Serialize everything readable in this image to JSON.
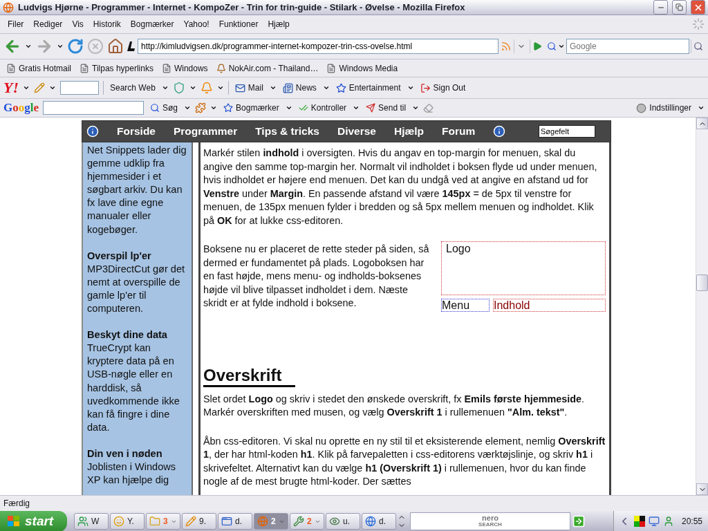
{
  "window": {
    "title": "Ludvigs Hjørne - Programmer - Internet - KompoZer - Trin for trin-guide - Stilark - Øvelse - Mozilla Firefox"
  },
  "menu": [
    "Filer",
    "Rediger",
    "Vis",
    "Historik",
    "Bogmærker",
    "Yahoo!",
    "Funktioner",
    "Hjælp"
  ],
  "navigation": {
    "url": "http://kimludvigsen.dk/programmer-internet-kompozer-trin-css-ovelse.html",
    "search_placeholder": "Google"
  },
  "bookmarks": [
    {
      "label": "Gratis Hotmail",
      "kind": "page"
    },
    {
      "label": "Tilpas hyperlinks",
      "kind": "page"
    },
    {
      "label": "Windows",
      "kind": "page"
    },
    {
      "label": "NokAir.com - Thailand…",
      "kind": "site"
    },
    {
      "label": "Windows Media",
      "kind": "page"
    }
  ],
  "yahoo_toolbar": {
    "logo": "Y!",
    "items": [
      {
        "label": "Search Web",
        "kind": "search"
      },
      {
        "label": "Mail",
        "kind": "mail"
      },
      {
        "label": "News",
        "kind": "news"
      },
      {
        "label": "Entertainment",
        "kind": "star"
      },
      {
        "label": "Sign Out",
        "kind": "signout"
      }
    ]
  },
  "google_toolbar": {
    "logo": "Google",
    "items": [
      {
        "label": "Søg",
        "kind": "search"
      },
      {
        "label": "Bogmærker",
        "kind": "star"
      },
      {
        "label": "Kontroller",
        "kind": "check"
      },
      {
        "label": "Send til",
        "kind": "send"
      }
    ],
    "settings": "Indstillinger"
  },
  "page": {
    "nav": [
      "Forside",
      "Programmer",
      "Tips & tricks",
      "Diverse",
      "Hjælp",
      "Forum"
    ],
    "search_value": "Søgefelt",
    "sidebar": [
      {
        "text": "Net Snippets lader dig gemme udklip fra hjemmesider i et søgbart arkiv. Du kan fx lave dine egne manualer eller kogebøger."
      },
      {
        "title": "Overspil lp'er",
        "text": "MP3DirectCut gør det nemt at overspille de gamle lp'er til computeren."
      },
      {
        "title": "Beskyt dine data",
        "text": "TrueCrypt kan kryptere data på en USB-nøgle eller en harddisk, så uvedkommende ikke kan få fingre i dine data."
      },
      {
        "title": "Din ven i nøden",
        "text": "Joblisten i Windows XP kan hjælpe dig"
      }
    ],
    "main": [
      {
        "kind": "paragraph",
        "text": "Markér stilen **indhold** i oversigten. Hvis du angav en top-margin for menuen, skal du angive den samme top-margin her. Normalt vil indholdet i boksen flyde ud under menuen, hvis indholdet er højere end menuen. Det kan du undgå ved at angive en afstand ud for **Venstre** under **Margin**. En passende afstand vil være **145px** = de 5px til venstre for menuen, de 135px menuen fylder i bredden og så 5px mellem menuen og indholdet. Klik på **OK** for at lukke css-editoren."
      },
      {
        "kind": "figure",
        "text": "Boksene nu er placeret de rette steder på siden, så dermed er fundamentet på plads. Logoboksen har en fast højde, mens menu- og indholds-boksenes højde vil blive tilpasset indholdet i dem. Næste skridt er at fylde indhold i boksene.",
        "logo": "Logo",
        "menu": "Menu",
        "content": "Indhold"
      },
      {
        "kind": "heading",
        "text": "Overskrift"
      },
      {
        "kind": "paragraph",
        "text": "Slet ordet **Logo** og skriv i stedet den ønskede overskrift, fx **Emils første hjemmeside**. Markér overskriften med musen, og vælg **Overskrift 1** i rullemenuen **\"Alm. tekst\"**."
      },
      {
        "kind": "paragraph",
        "text": "Åbn css-editoren. Vi skal nu oprette en ny stil til et eksisterende element, nemlig **Overskrift 1**, der har html-koden **h1**. Klik på farvepaletten i css-editorens værktøjslinje, og skriv **h1** i skrivefeltet. Alternativt kan du vælge **h1 (Overskrift 1)** i rullemenuen, hvor du kan finde nogle af de mest brugte html-koder. Der sættes"
      }
    ]
  },
  "status_bar": "Færdig",
  "taskbar": {
    "start": "start",
    "buttons": [
      {
        "label": "W",
        "kind": "people",
        "grouped": false,
        "selected": false
      },
      {
        "label": "Y.",
        "kind": "smiley",
        "grouped": false,
        "selected": false
      },
      {
        "label": "3",
        "kind": "folder",
        "grouped": true,
        "selected": false
      },
      {
        "label": "9.",
        "kind": "pencil",
        "grouped": false,
        "selected": false
      },
      {
        "label": "d.",
        "kind": "window",
        "grouped": false,
        "selected": false
      },
      {
        "label": "2",
        "kind": "firefox",
        "grouped": true,
        "selected": true
      },
      {
        "label": "2",
        "kind": "tool",
        "grouped": true,
        "selected": false
      },
      {
        "label": "u.",
        "kind": "eye",
        "grouped": false,
        "selected": false
      },
      {
        "label": "d.",
        "kind": "globe",
        "grouped": false,
        "selected": false
      }
    ],
    "search_logo": "nero",
    "search_logo_sub": "SEARCH",
    "clock": "20:55"
  }
}
